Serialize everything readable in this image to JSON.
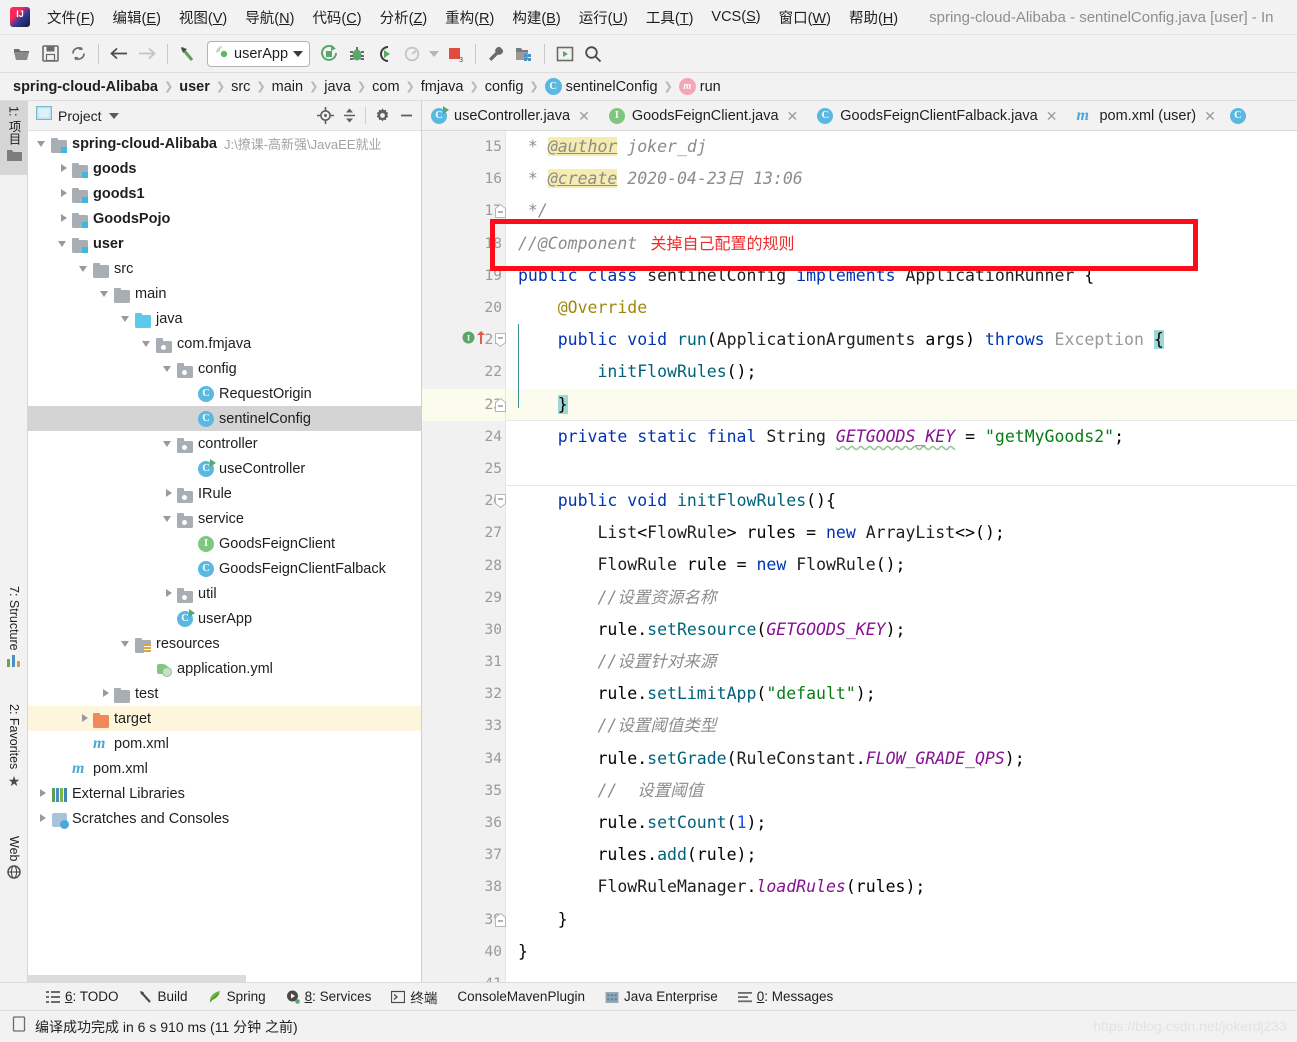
{
  "window": {
    "title": "spring-cloud-Alibaba - sentinelConfig.java [user] - In"
  },
  "menubar": {
    "items": [
      {
        "label": "文件(F)",
        "name": "menu-file"
      },
      {
        "label": "编辑(E)",
        "name": "menu-edit"
      },
      {
        "label": "视图(V)",
        "name": "menu-view"
      },
      {
        "label": "导航(N)",
        "name": "menu-navigate"
      },
      {
        "label": "代码(C)",
        "name": "menu-code"
      },
      {
        "label": "分析(Z)",
        "name": "menu-analyze"
      },
      {
        "label": "重构(R)",
        "name": "menu-refactor"
      },
      {
        "label": "构建(B)",
        "name": "menu-build"
      },
      {
        "label": "运行(U)",
        "name": "menu-run"
      },
      {
        "label": "工具(T)",
        "name": "menu-tools"
      },
      {
        "label": "VCS(S)",
        "name": "menu-vcs"
      },
      {
        "label": "窗口(W)",
        "name": "menu-window"
      },
      {
        "label": "帮助(H)",
        "name": "menu-help"
      }
    ]
  },
  "toolbar": {
    "run_config": "userApp",
    "icons": [
      "open-folder-icon",
      "save-icon",
      "sync-icon",
      "back-arrow-icon",
      "forward-arrow-icon",
      "revert-icon",
      "run-icon",
      "debug-icon",
      "run-coverage-icon",
      "profile-icon",
      "stop-icon",
      "settings-wrench-icon",
      "project-structure-icon",
      "update-icon",
      "search-everywhere-icon"
    ]
  },
  "breadcrumb": {
    "items": [
      {
        "label": "spring-cloud-Alibaba",
        "bold": true,
        "icon": ""
      },
      {
        "label": "user",
        "bold": true,
        "icon": ""
      },
      {
        "label": "src",
        "bold": false,
        "icon": ""
      },
      {
        "label": "main",
        "bold": false,
        "icon": ""
      },
      {
        "label": "java",
        "bold": false,
        "icon": ""
      },
      {
        "label": "com",
        "bold": false,
        "icon": ""
      },
      {
        "label": "fmjava",
        "bold": false,
        "icon": ""
      },
      {
        "label": "config",
        "bold": false,
        "icon": ""
      },
      {
        "label": "sentinelConfig",
        "bold": false,
        "icon": "class-icon"
      },
      {
        "label": "run",
        "bold": false,
        "icon": "method-icon"
      }
    ]
  },
  "left_toolstrip": {
    "top_tab": "1: 项目",
    "bottom_tabs": [
      "7: Structure",
      "2: Favorites",
      "Web"
    ]
  },
  "project_panel": {
    "title": "Project",
    "header_icons": [
      "locate-target-icon",
      "collapse-all-icon",
      "gear-icon",
      "hide-icon"
    ],
    "tree": [
      {
        "depth": 0,
        "arrow": "down",
        "icon": "module-folder",
        "label": "spring-cloud-Alibaba",
        "bold": true,
        "path": "J:\\撩课-高新强\\JavaEE就业"
      },
      {
        "depth": 1,
        "arrow": "right",
        "icon": "module-folder",
        "label": "goods",
        "bold": true
      },
      {
        "depth": 1,
        "arrow": "right",
        "icon": "module-folder",
        "label": "goods1",
        "bold": true
      },
      {
        "depth": 1,
        "arrow": "right",
        "icon": "module-folder",
        "label": "GoodsPojo",
        "bold": true
      },
      {
        "depth": 1,
        "arrow": "down",
        "icon": "module-folder",
        "label": "user",
        "bold": true
      },
      {
        "depth": 2,
        "arrow": "down",
        "icon": "folder",
        "label": "src"
      },
      {
        "depth": 3,
        "arrow": "down",
        "icon": "folder",
        "label": "main"
      },
      {
        "depth": 4,
        "arrow": "down",
        "icon": "folder-blue",
        "label": "java"
      },
      {
        "depth": 5,
        "arrow": "down",
        "icon": "package",
        "label": "com.fmjava"
      },
      {
        "depth": 6,
        "arrow": "down",
        "icon": "package",
        "label": "config"
      },
      {
        "depth": 7,
        "arrow": "none",
        "icon": "class",
        "label": "RequestOrigin"
      },
      {
        "depth": 7,
        "arrow": "none",
        "icon": "class",
        "label": "sentinelConfig",
        "selected": true
      },
      {
        "depth": 6,
        "arrow": "down",
        "icon": "package",
        "label": "controller"
      },
      {
        "depth": 7,
        "arrow": "none",
        "icon": "class-runnable",
        "label": "useController"
      },
      {
        "depth": 6,
        "arrow": "right",
        "icon": "package",
        "label": "IRule"
      },
      {
        "depth": 6,
        "arrow": "down",
        "icon": "package",
        "label": "service"
      },
      {
        "depth": 7,
        "arrow": "none",
        "icon": "interface",
        "label": "GoodsFeignClient"
      },
      {
        "depth": 7,
        "arrow": "none",
        "icon": "class",
        "label": "GoodsFeignClientFalback"
      },
      {
        "depth": 6,
        "arrow": "right",
        "icon": "package",
        "label": "util"
      },
      {
        "depth": 6,
        "arrow": "none",
        "icon": "spring-class",
        "label": "userApp"
      },
      {
        "depth": 4,
        "arrow": "down",
        "icon": "resources",
        "label": "resources"
      },
      {
        "depth": 5,
        "arrow": "none",
        "icon": "yml",
        "label": "application.yml"
      },
      {
        "depth": 3,
        "arrow": "right",
        "icon": "folder",
        "label": "test"
      },
      {
        "depth": 2,
        "arrow": "right",
        "icon": "folder-orange",
        "label": "target",
        "highlight": true
      },
      {
        "depth": 2,
        "arrow": "none",
        "icon": "maven",
        "label": "pom.xml"
      },
      {
        "depth": 1,
        "arrow": "none",
        "icon": "maven",
        "label": "pom.xml"
      },
      {
        "depth": 0,
        "arrow": "right",
        "icon": "library",
        "label": "External Libraries"
      },
      {
        "depth": 0,
        "arrow": "right",
        "icon": "scratch",
        "label": "Scratches and Consoles"
      }
    ]
  },
  "editor": {
    "tabs": [
      {
        "label": "useController.java",
        "icon": "class-runnable-icon"
      },
      {
        "label": "GoodsFeignClient.java",
        "icon": "interface-icon"
      },
      {
        "label": "GoodsFeignClientFalback.java",
        "icon": "class-icon"
      },
      {
        "label": "pom.xml (user)",
        "icon": "maven-icon"
      }
    ],
    "annotation_note": "关掉自己配置的规则",
    "lines": [
      {
        "num": 15,
        "text": " * @author joker_dj"
      },
      {
        "num": 16,
        "text": " * @create 2020-04-23日 13:06"
      },
      {
        "num": 17,
        "text": " */"
      },
      {
        "num": 18,
        "text": "//@Component"
      },
      {
        "num": 19,
        "text": "public class sentinelConfig implements ApplicationRunner {"
      },
      {
        "num": 20,
        "text": "    @Override"
      },
      {
        "num": 21,
        "text": "    public void run(ApplicationArguments args) throws Exception {"
      },
      {
        "num": 22,
        "text": "        initFlowRules();"
      },
      {
        "num": 23,
        "text": "    }"
      },
      {
        "num": 24,
        "text": "    private static final String GETGOODS_KEY = \"getMyGoods2\";"
      },
      {
        "num": 25,
        "text": ""
      },
      {
        "num": 26,
        "text": "    public void initFlowRules(){"
      },
      {
        "num": 27,
        "text": "        List<FlowRule> rules = new ArrayList<>();"
      },
      {
        "num": 28,
        "text": "        FlowRule rule = new FlowRule();"
      },
      {
        "num": 29,
        "text": "        //设置资源名称"
      },
      {
        "num": 30,
        "text": "        rule.setResource(GETGOODS_KEY);"
      },
      {
        "num": 31,
        "text": "        //设置针对来源"
      },
      {
        "num": 32,
        "text": "        rule.setLimitApp(\"default\");"
      },
      {
        "num": 33,
        "text": "        //设置阈值类型"
      },
      {
        "num": 34,
        "text": "        rule.setGrade(RuleConstant.FLOW_GRADE_QPS);"
      },
      {
        "num": 35,
        "text": "        //  设置阈值"
      },
      {
        "num": 36,
        "text": "        rule.setCount(1);"
      },
      {
        "num": 37,
        "text": "        rules.add(rule);"
      },
      {
        "num": 38,
        "text": "        FlowRuleManager.loadRules(rules);"
      },
      {
        "num": 39,
        "text": "    }"
      },
      {
        "num": 40,
        "text": "}"
      },
      {
        "num": 41,
        "text": ""
      }
    ]
  },
  "toolwindow_bar": {
    "items": [
      {
        "label": "6: TODO",
        "icon": "todo-icon"
      },
      {
        "label": "Build",
        "icon": "build-hammer-icon"
      },
      {
        "label": "Spring",
        "icon": "spring-leaf-icon"
      },
      {
        "label": "8: Services",
        "icon": "services-icon"
      },
      {
        "label": "终端",
        "icon": "terminal-icon"
      },
      {
        "label": "ConsoleMavenPlugin",
        "icon": ""
      },
      {
        "label": "Java Enterprise",
        "icon": "java-enterprise-icon"
      },
      {
        "label": "0: Messages",
        "icon": "messages-icon"
      }
    ]
  },
  "statusbar": {
    "message": "编译成功完成 in 6 s 910 ms (11 分钟 之前)",
    "icon": "build-status-icon"
  },
  "watermark": "https://blog.csdn.net/jokerdj233",
  "colors": {
    "accent_red": "#fc0d1c",
    "note_red": "#ef2a2a",
    "keyword_blue": "#0033b3",
    "string_green": "#067d17",
    "constant_purple": "#871094",
    "comment_gray": "#8c8c8c",
    "selection_cyan": "#9fd6d6",
    "highlight_yellow": "#fbfbee"
  }
}
